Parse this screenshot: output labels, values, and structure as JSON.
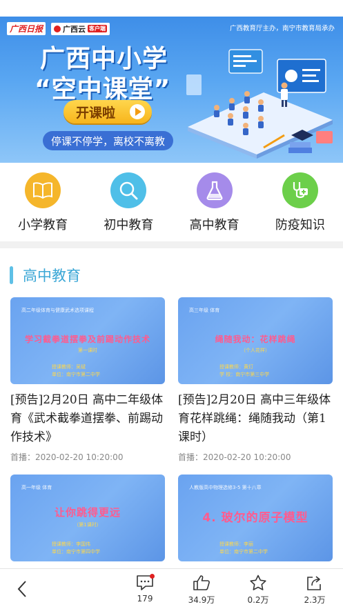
{
  "banner": {
    "logo_left": "广西日报",
    "logo_right": "广西云",
    "logo_right_tag": "客户端",
    "sponsor": "广西教育厅主办，南宁市教育局承办",
    "title_line1": "广西中小学",
    "title_line2": "“空中课堂”",
    "start_button": "开课啦",
    "slogan": "停课不停学，离校不离教"
  },
  "categories": [
    {
      "label": "小学教育",
      "icon": "book-icon",
      "color": "#f5b62b"
    },
    {
      "label": "初中教育",
      "icon": "search-icon",
      "color": "#4fbfe8"
    },
    {
      "label": "高中教育",
      "icon": "flask-icon",
      "color": "#a58bea"
    },
    {
      "label": "防疫知识",
      "icon": "stethoscope-icon",
      "color": "#6ccf4a"
    }
  ],
  "section": {
    "title": "高中教育"
  },
  "cards": [
    {
      "thumb_header": "高二年级体育与健康武术选项课程",
      "thumb_title": "学习截拳道摆拳及前踢动作技术",
      "thumb_sub": "第一课时",
      "thumb_info1": "授课教师：吴斌",
      "thumb_info2": "单位：南宁市第二中学",
      "title": "[预告]2月20日 高中二年级体育《武术截拳道摆拳、前踢动作技术》",
      "date": "首播：2020-02-20 10:20:00"
    },
    {
      "thumb_header": "高三年级 体育",
      "thumb_title": "绳随我动：花样跳绳",
      "thumb_sub": "（个人花样）",
      "thumb_info1": "授课教师：黄灯",
      "thumb_info2": "学  校：南宁市第三中学",
      "title": "[预告]2月20日 高中三年级体育花样跳绳：绳随我动（第1课时）",
      "date": "首播：2020-02-20 10:20:00"
    },
    {
      "thumb_header": "高一年级 体育",
      "thumb_title": "让你跳得更远",
      "thumb_sub": "（第1课时）",
      "thumb_info1": "授课教师：李国伟",
      "thumb_info2": "单位：南宁市第四中学",
      "title": "",
      "date": ""
    },
    {
      "thumb_header": "人教版高中物理选修3-5 第十八章",
      "thumb_title": "4. 玻尔的原子模型",
      "thumb_sub": "",
      "thumb_info1": "授课教师：李丽",
      "thumb_info2": "单位：南宁市第二中学",
      "title": "",
      "date": ""
    }
  ],
  "bottom_bar": {
    "comments": "179",
    "likes": "34.9万",
    "favorites": "0.2万",
    "shares": "2.3万"
  }
}
